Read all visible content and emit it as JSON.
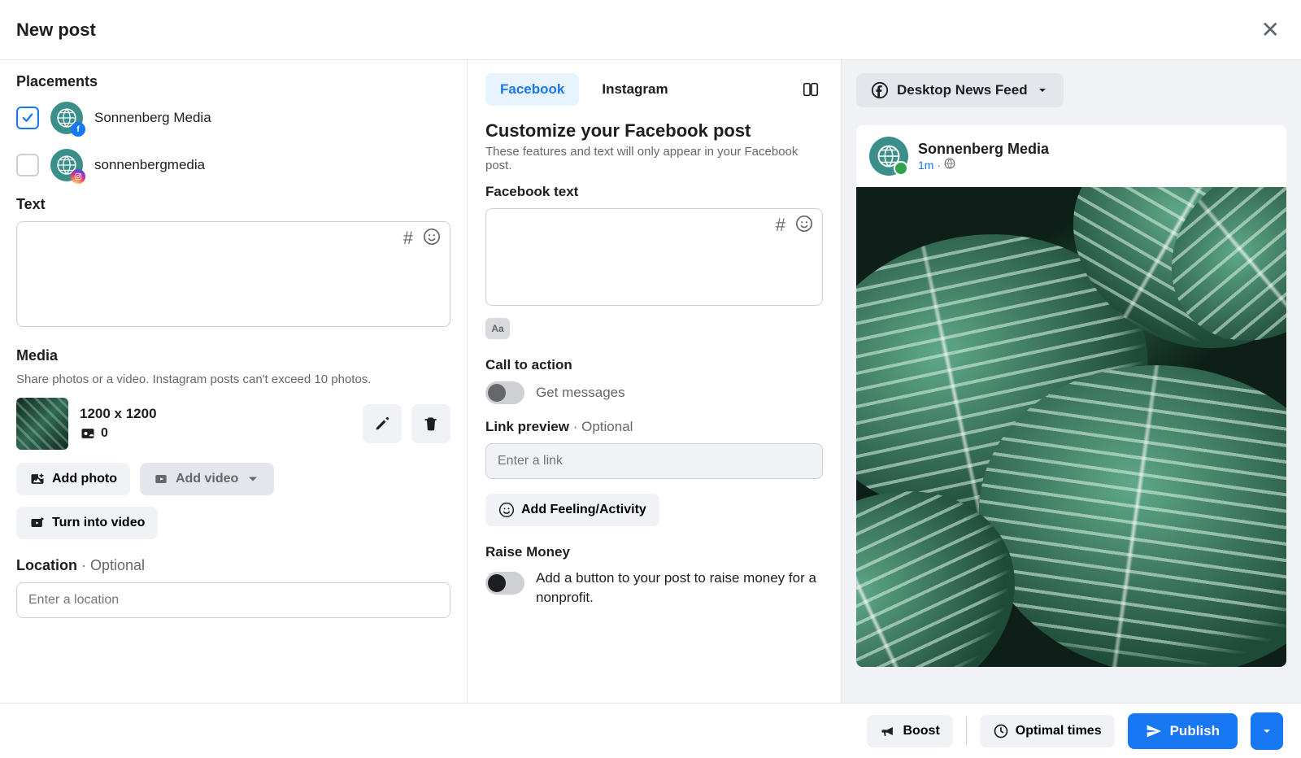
{
  "header": {
    "title": "New post"
  },
  "left": {
    "placements_heading": "Placements",
    "placements": [
      {
        "label": "Sonnenberg Media",
        "checked": true,
        "network": "fb"
      },
      {
        "label": "sonnenbergmedia",
        "checked": false,
        "network": "ig"
      }
    ],
    "text_heading": "Text",
    "media_heading": "Media",
    "media_desc": "Share photos or a video. Instagram posts can't exceed 10 photos.",
    "media": {
      "dimensions": "1200 x 1200",
      "count": "0"
    },
    "add_photo": "Add photo",
    "add_video": "Add video",
    "turn_video": "Turn into video",
    "location_heading": "Location",
    "optional": "Optional",
    "location_placeholder": "Enter a location"
  },
  "mid": {
    "tabs": [
      {
        "label": "Facebook",
        "active": true
      },
      {
        "label": "Instagram",
        "active": false
      }
    ],
    "customize_title": "Customize your Facebook post",
    "customize_desc": "These features and text will only appear in your Facebook post.",
    "fb_text_heading": "Facebook text",
    "cta_heading": "Call to action",
    "cta_label": "Get messages",
    "link_heading": "Link preview",
    "optional": "Optional",
    "link_placeholder": "Enter a link",
    "feeling_btn": "Add Feeling/Activity",
    "raise_heading": "Raise Money",
    "raise_desc": "Add a button to your post to raise money for a nonprofit."
  },
  "right": {
    "preview_selector": "Desktop News Feed",
    "page_name": "Sonnenberg Media",
    "time": "1m"
  },
  "footer": {
    "boost": "Boost",
    "optimal": "Optimal times",
    "publish": "Publish"
  }
}
